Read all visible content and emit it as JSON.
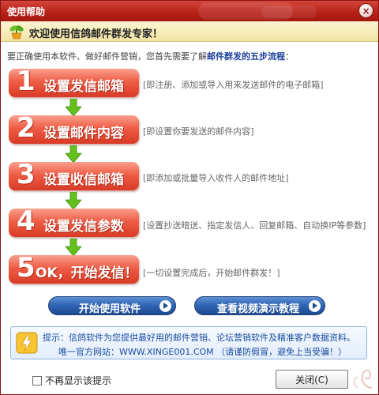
{
  "window": {
    "title": "使用帮助",
    "close_symbol": "×"
  },
  "welcome": {
    "text": "欢迎使用信鸽邮件群发专家！",
    "icon": "plant-icon"
  },
  "intro": {
    "prefix": "要正确使用本软件、做好邮件营销，您首先需要了解",
    "highlight": "邮件群发的五步流程",
    "suffix": "："
  },
  "steps": [
    {
      "num": "1",
      "label": "设置发信邮箱",
      "desc": "[即注册、添加或导入用来发送邮件的电子邮箱]"
    },
    {
      "num": "2",
      "label": "设置邮件内容",
      "desc": "[即设置你要发送的邮件内容]"
    },
    {
      "num": "3",
      "label": "设置收信邮箱",
      "desc": "[即添加或批量导入收件人的邮件地址]"
    },
    {
      "num": "4",
      "label": "设置发信参数",
      "desc": "[设置抄送暗送、指定发信人、回复邮箱、自动换IP等参数]"
    },
    {
      "num": "5",
      "label": "OK，开始发信！",
      "desc": "[一切设置完成后，开始邮件群发！]"
    }
  ],
  "actions": {
    "start_label": "开始使用软件",
    "video_label": "查看视频演示教程"
  },
  "tip": {
    "line1": "提示：信鸽软件为您提供最好用的邮件营销、论坛营销软件及精准客户数据资料。",
    "line2": "唯一官方网站：WWW.XINGE001.COM （请谨防假冒，避免上当受骗！）"
  },
  "footer": {
    "dont_show_label": "不再显示该提示",
    "close_label": "关闭(C)"
  },
  "colors": {
    "title_bar": "#b82219",
    "step_red": "#ef5d46",
    "arrow_green": "#63c11e",
    "action_blue": "#2c5fae",
    "tip_text": "#1b4aa0"
  }
}
